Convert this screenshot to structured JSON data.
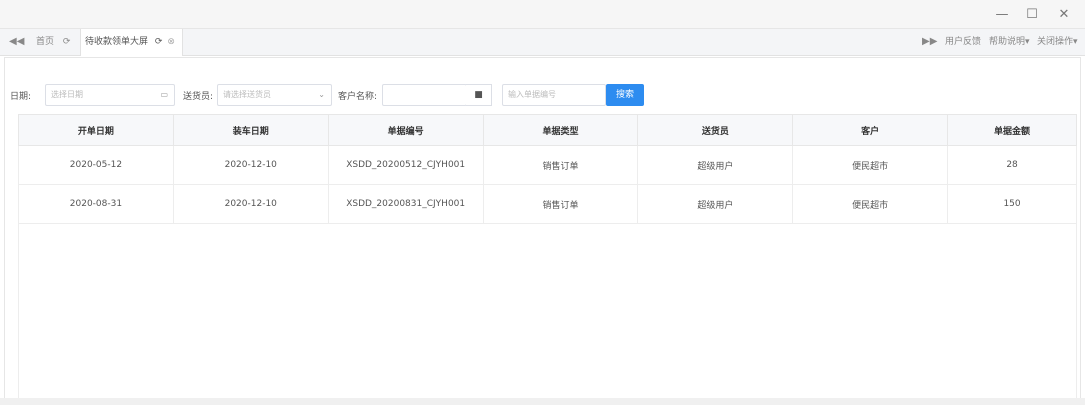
{
  "window": {
    "minimize": "—",
    "maximize": "☐",
    "close": "✕"
  },
  "tabs": {
    "home": "首页",
    "active": "待收款领单大屏"
  },
  "toolbar_right": {
    "feedback": "用户反馈",
    "help": "帮助说明",
    "close_ops": "关闭操作"
  },
  "filter": {
    "date_label": "日期:",
    "date_placeholder": "选择日期",
    "courier_label": "送货员:",
    "courier_placeholder": "请选择送货员",
    "customer_label": "客户名称:",
    "customer_value": "",
    "order_placeholder": "输入单据编号",
    "search_label": "搜索"
  },
  "table": {
    "headers": [
      "开单日期",
      "装车日期",
      "单据编号",
      "单据类型",
      "送货员",
      "客户",
      "单据金额"
    ],
    "rows": [
      [
        "2020-05-12",
        "2020-12-10",
        "XSDD_20200512_CJYH001",
        "销售订单",
        "超级用户",
        "便民超市",
        "28"
      ],
      [
        "2020-08-31",
        "2020-12-10",
        "XSDD_20200831_CJYH001",
        "销售订单",
        "超级用户",
        "便民超市",
        "150"
      ]
    ]
  }
}
